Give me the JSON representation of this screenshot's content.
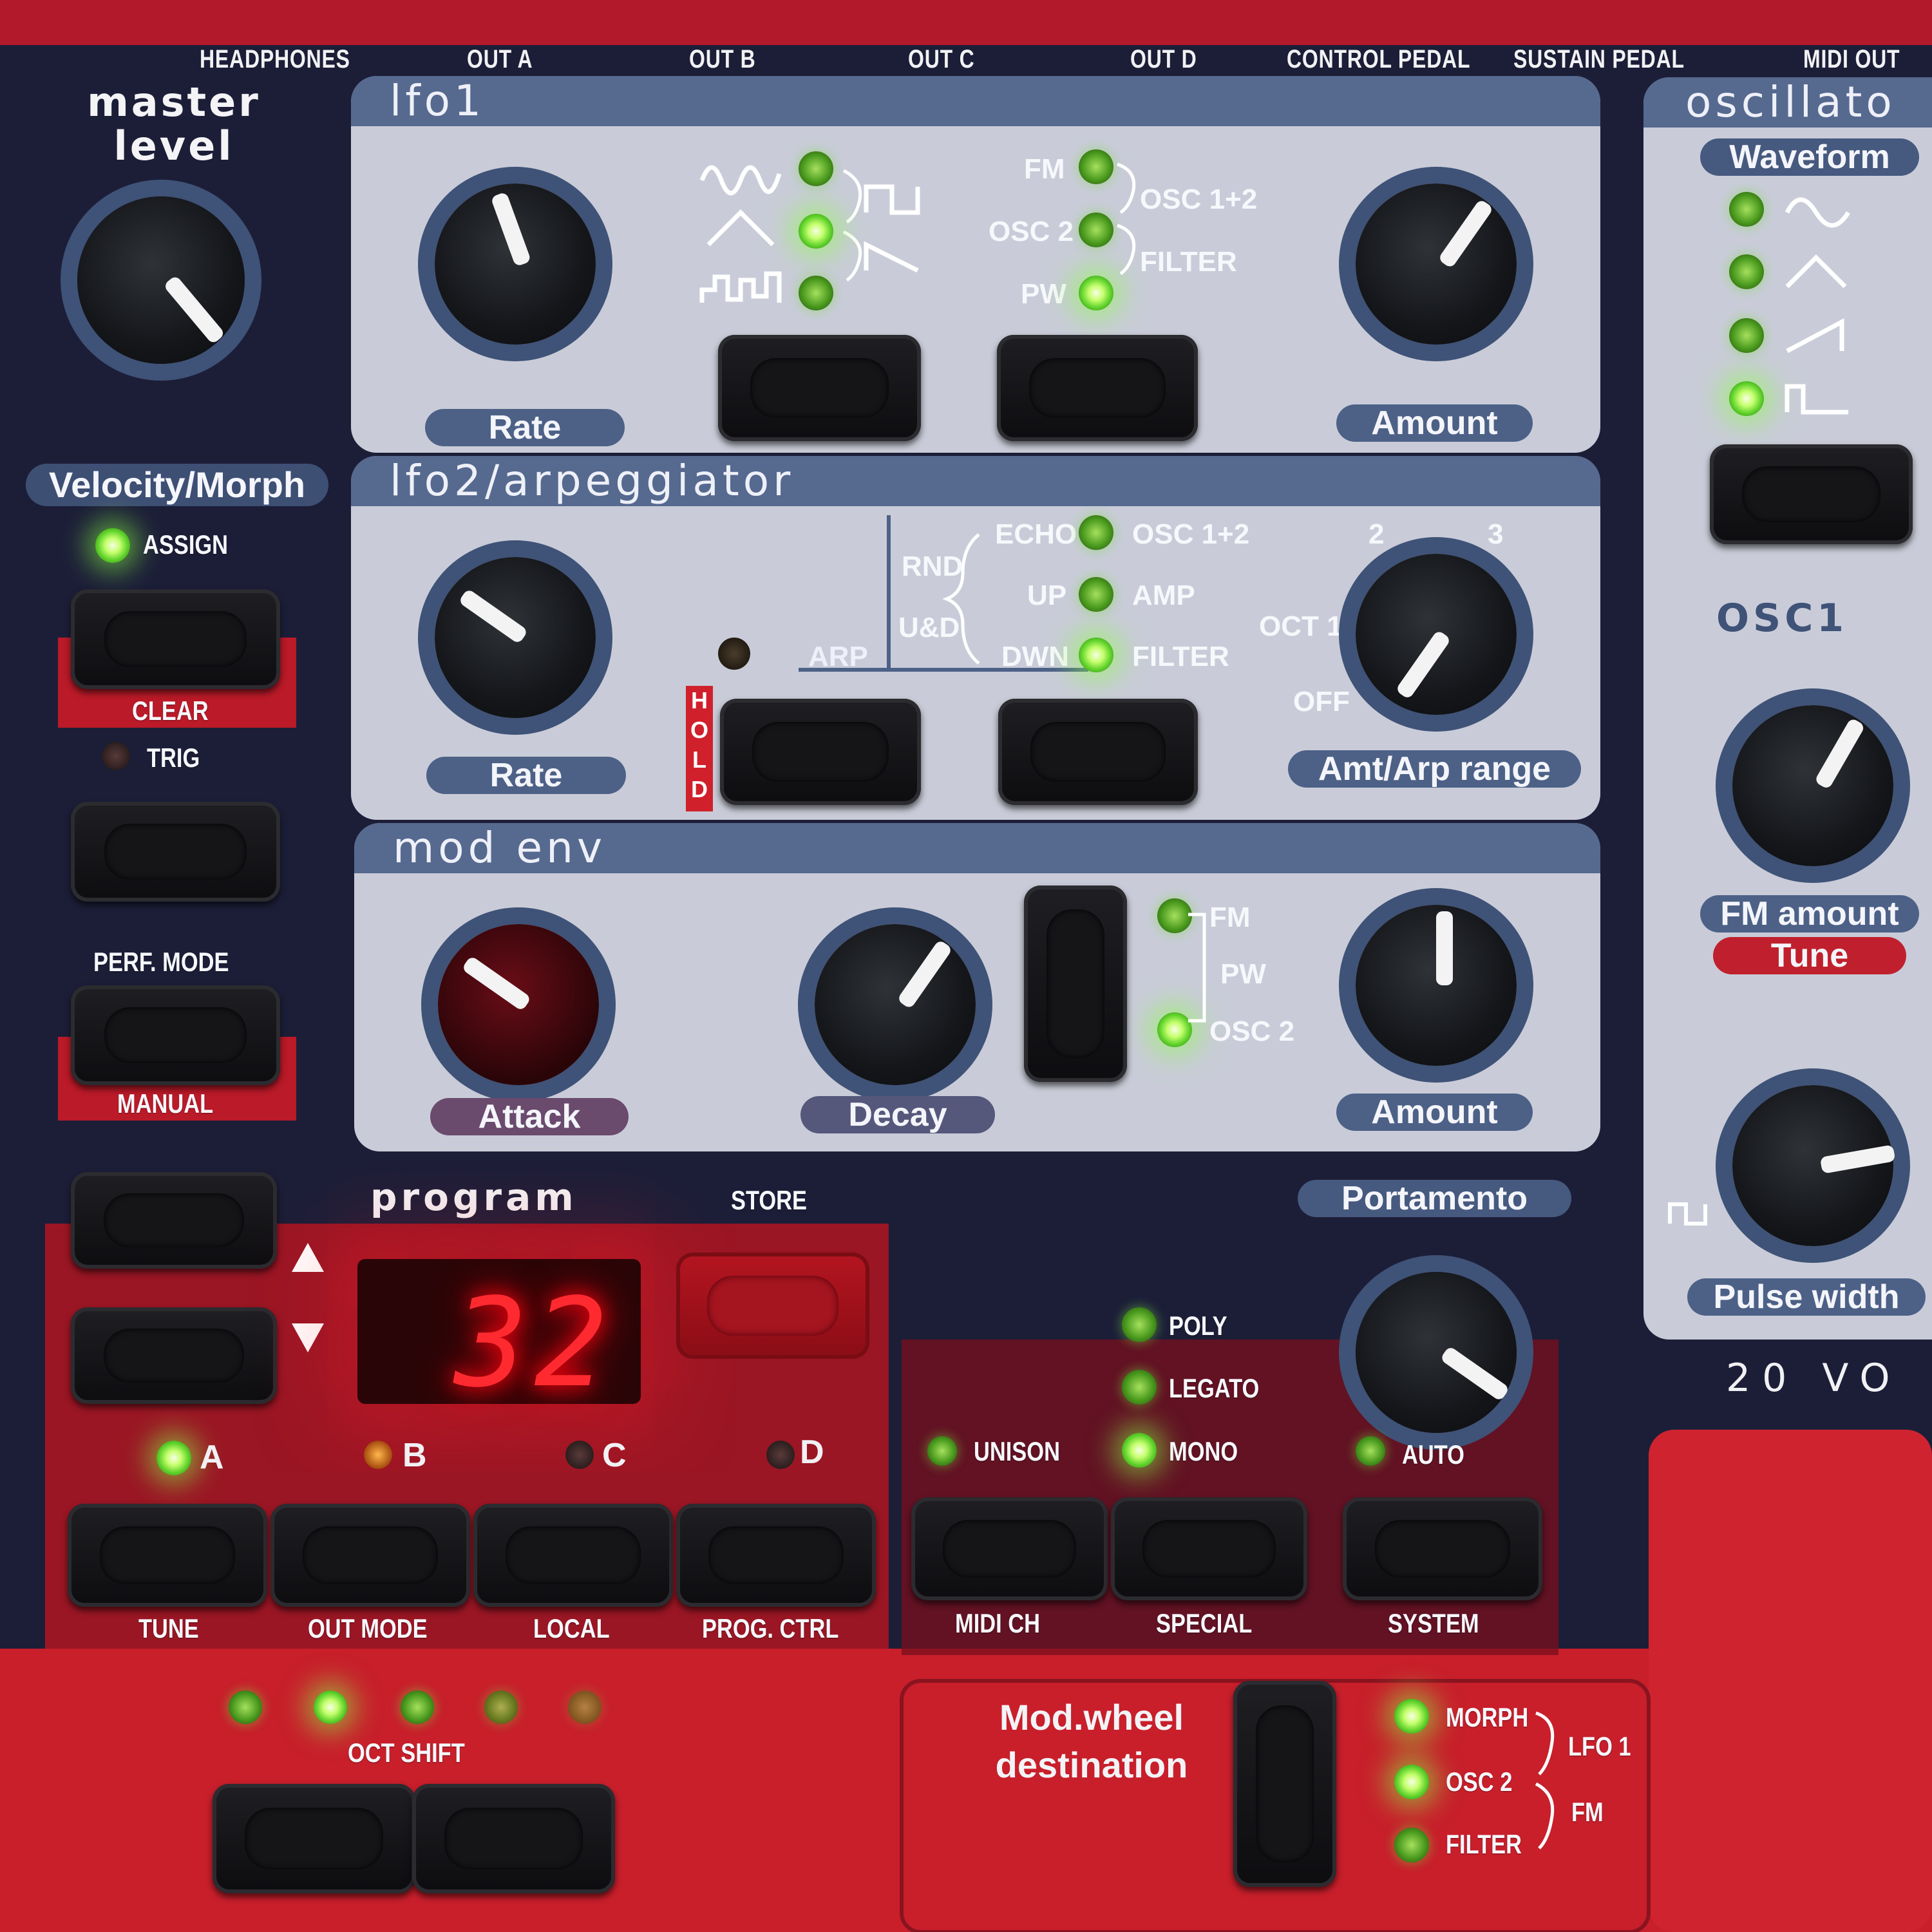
{
  "top_labels": {
    "headphones": "HEADPHONES",
    "out_a": "OUT A",
    "out_b": "OUT B",
    "out_c": "OUT C",
    "out_d": "OUT D",
    "control_pedal": "CONTROL PEDAL",
    "sustain_pedal": "SUSTAIN PEDAL",
    "midi_out": "MIDI OUT"
  },
  "master": {
    "line1": "master",
    "line2": "level"
  },
  "velocity_morph": {
    "title": "Velocity/Morph",
    "assign": "ASSIGN",
    "clear": "CLEAR",
    "trig": "TRIG",
    "perf_mode": "PERF. MODE",
    "manual": "MANUAL"
  },
  "lfo1": {
    "title": "lfo1",
    "rate_label": "Rate",
    "amount_label": "Amount",
    "dest": [
      "FM",
      "OSC 2",
      "PW"
    ],
    "dest_groups": [
      "OSC 1+2",
      "FILTER"
    ]
  },
  "lfo2": {
    "title": "lfo2/arpeggiator",
    "rate_label": "Rate",
    "arp": "ARP",
    "hold": "HOLD",
    "modes": [
      "ECHO",
      "UP",
      "DWN"
    ],
    "mode_groups": [
      "RND",
      "U&D"
    ],
    "dest": [
      "OSC 1+2",
      "AMP",
      "FILTER"
    ],
    "range_marks": [
      "2",
      "3",
      "OCT 1",
      "OFF"
    ],
    "range_label": "Amt/Arp range"
  },
  "mod_env": {
    "title": "mod env",
    "attack_label": "Attack",
    "decay_label": "Decay",
    "dest": [
      "FM",
      "PW",
      "OSC 2"
    ],
    "amount_label": "Amount"
  },
  "oscillator": {
    "title": "oscillato",
    "waveform_label": "Waveform",
    "osc1": "OSC1",
    "fm_amount": "FM amount",
    "tune": "Tune",
    "pulse_width": "Pulse width",
    "voices": "20 VO"
  },
  "program": {
    "title": "program",
    "store": "STORE",
    "display": "32",
    "banks": [
      "A",
      "B",
      "C",
      "D"
    ],
    "functions": [
      "TUNE",
      "OUT MODE",
      "LOCAL",
      "PROG. CTRL"
    ]
  },
  "voice_mode": {
    "modes": [
      "POLY",
      "LEGATO",
      "MONO"
    ],
    "unison": "UNISON",
    "functions": [
      "MIDI CH",
      "SPECIAL"
    ]
  },
  "portamento": {
    "label": "Portamento",
    "auto": "AUTO",
    "system": "SYSTEM"
  },
  "oct_shift": {
    "label": "OCT SHIFT"
  },
  "mod_wheel": {
    "line1": "Mod.wheel",
    "line2": "destination",
    "dest": [
      "MORPH",
      "OSC 2",
      "FILTER"
    ],
    "groups": [
      "LFO 1",
      "FM"
    ]
  }
}
